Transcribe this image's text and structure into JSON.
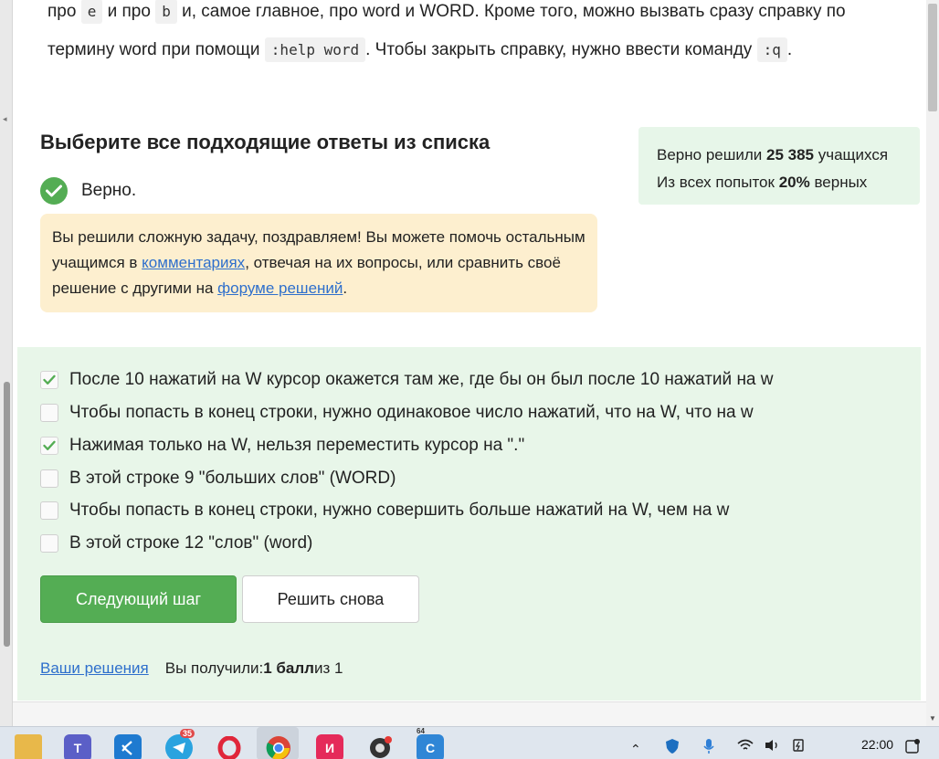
{
  "intro": {
    "l1_a": "про ",
    "code_e": "e",
    "l1_b": " и про ",
    "code_b": "b",
    "l1_c": " и, самое главное, про word и WORD. Кроме того, можно вызвать сразу справку по",
    "l2_a": "термину word при помощи ",
    "code_help": ":help word",
    "l2_b": ". Чтобы закрыть справку, нужно ввести команду ",
    "code_q": ":q",
    "l2_c": "."
  },
  "task": {
    "title": "Выберите все подходящие ответы из списка"
  },
  "stats": {
    "line1_prefix": "Верно решили ",
    "solvers": "25 385",
    "line1_suffix": " учащихся",
    "line2_prefix": "Из всех попыток ",
    "percent": "20%",
    "line2_suffix": " верных"
  },
  "verdict": {
    "label": "Верно."
  },
  "hint": {
    "t1": "Вы решили сложную задачу, поздравляем! Вы можете помочь остальным учащимся в ",
    "link_comments": "комментариях",
    "t2": ", отвечая на их вопросы, или сравнить своё решение с другими на ",
    "link_forum": "форуме решений",
    "t3": "."
  },
  "options": [
    {
      "label": "После 10 нажатий на W курсор окажется там же, где бы он был после 10 нажатий на w",
      "checked": true
    },
    {
      "label": "Чтобы попасть в конец строки, нужно одинаковое число нажатий, что на W, что на w",
      "checked": false
    },
    {
      "label": "Нажимая только на W, нельзя переместить курсор на \".\"",
      "checked": true
    },
    {
      "label": "В этой строке 9 \"больших слов\" (WORD)",
      "checked": false
    },
    {
      "label": "Чтобы попасть в конец строки, нужно совершить больше нажатий на W, чем на w",
      "checked": false
    },
    {
      "label": "В этой строке 12 \"слов\" (word)",
      "checked": false
    }
  ],
  "buttons": {
    "next": "Следующий шаг",
    "retry": "Решить снова"
  },
  "footer": {
    "solutions_link": "Ваши решения",
    "got_prefix": "Вы получили: ",
    "score": "1 балл",
    "got_suffix": " из 1"
  },
  "taskbar": {
    "telegram_badge": "35",
    "app_badge": "64",
    "time": "22:00",
    "notification_icon": "notification-icon"
  },
  "colors": {
    "accent_green": "#54ad54",
    "panel_green": "#e8f6e9",
    "hint_yellow": "#fdefcf",
    "link_blue": "#2e6fcc"
  }
}
